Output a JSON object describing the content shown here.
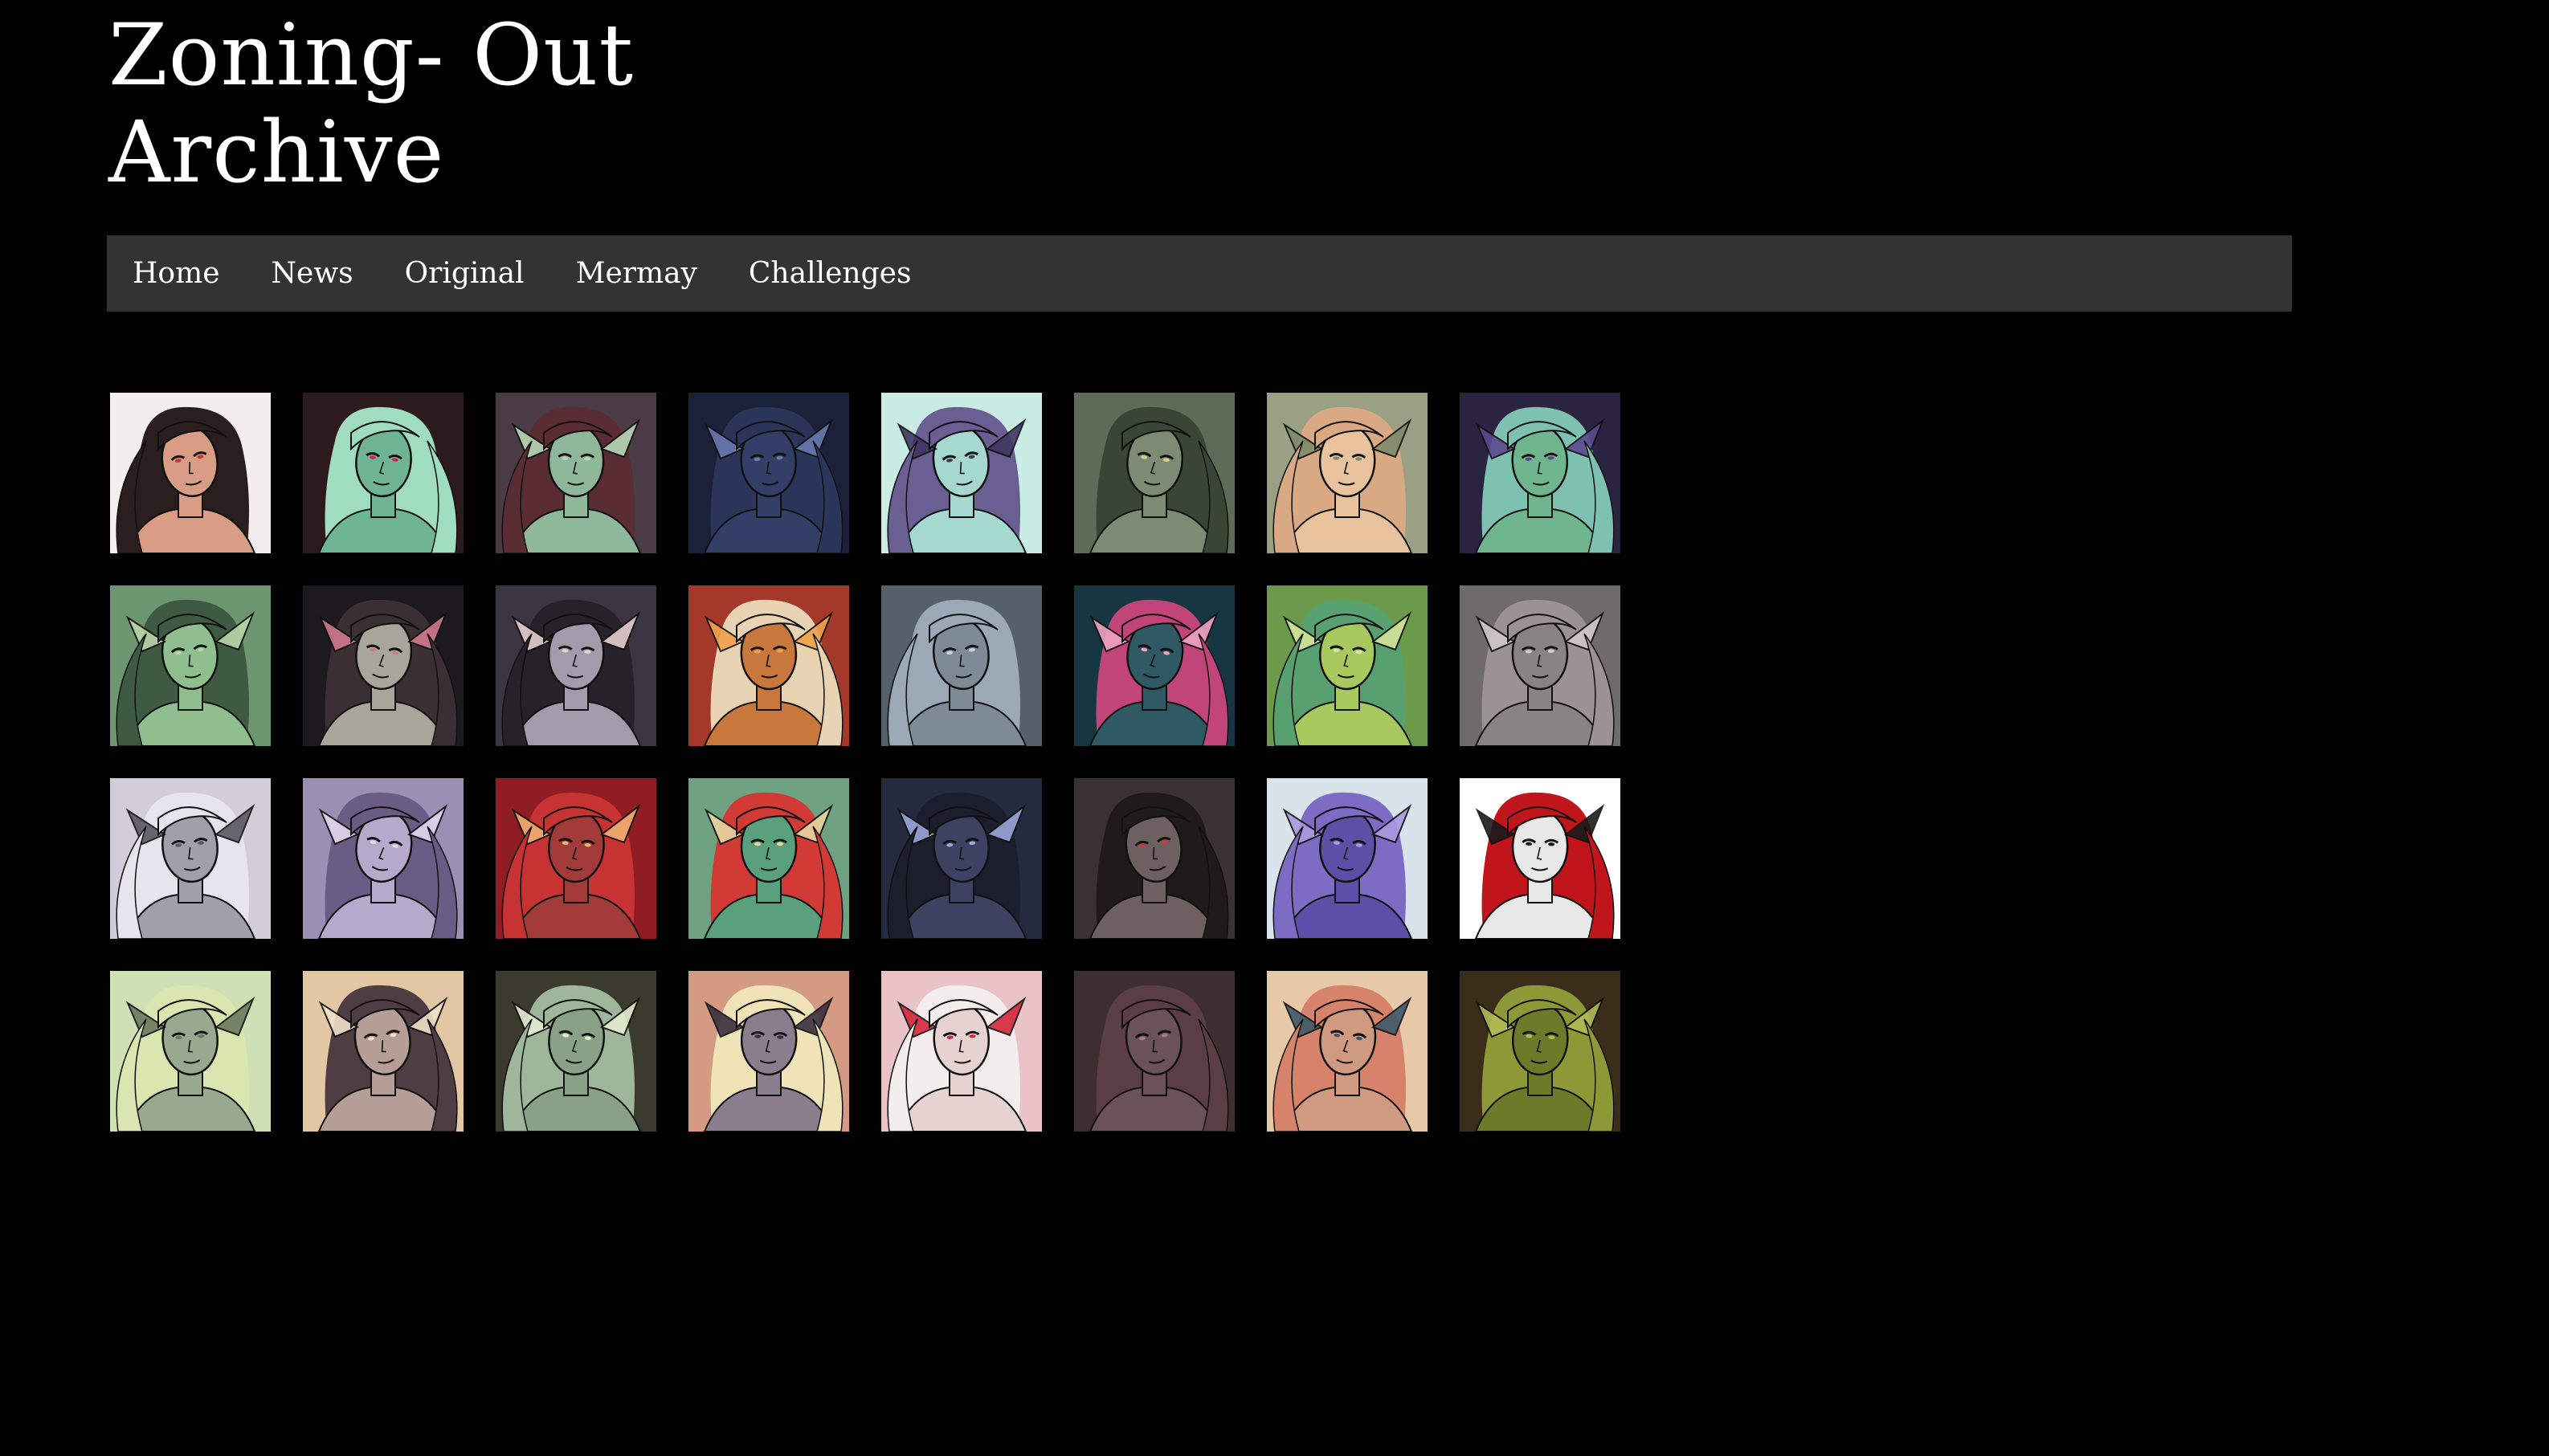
{
  "site": {
    "title_line1": "Zoning- Out",
    "title_line2": "Archive"
  },
  "nav": {
    "items": [
      {
        "label": "Home"
      },
      {
        "label": "News"
      },
      {
        "label": "Original"
      },
      {
        "label": "Mermay"
      },
      {
        "label": "Challenges"
      }
    ]
  },
  "colors": {
    "page_bg": "#000000",
    "nav_bg": "#333333",
    "text": "#ffffff"
  },
  "gallery": {
    "thumbnails": [
      {
        "bg": "#f4efee",
        "hair": "#2a1f1e",
        "skin": "#d99c84",
        "accent": "#c0392b",
        "fin": false
      },
      {
        "bg": "#2c1a1f",
        "hair": "#9fdcc0",
        "skin": "#6fb493",
        "accent": "#d6215e",
        "fin": false
      },
      {
        "bg": "#4a3b44",
        "hair": "#5a2c33",
        "skin": "#8fb79a",
        "accent": "#b8d8b6",
        "fin": true
      },
      {
        "bg": "#1b2138",
        "hair": "#2b3559",
        "skin": "#333f66",
        "accent": "#6a7ab0",
        "fin": true
      },
      {
        "bg": "#c9ece4",
        "hair": "#6a5f92",
        "skin": "#a5d9cf",
        "accent": "#3f3862",
        "fin": true
      },
      {
        "bg": "#5f6b57",
        "hair": "#3b4536",
        "skin": "#7e8b74",
        "accent": "#cfcf8a",
        "fin": false
      },
      {
        "bg": "#9aa083",
        "hair": "#d9a983",
        "skin": "#e8c39e",
        "accent": "#7e8a6a",
        "fin": true
      },
      {
        "bg": "#2b2440",
        "hair": "#7fc1b1",
        "skin": "#6fb58e",
        "accent": "#5b4a8f",
        "fin": true
      },
      {
        "bg": "#6c9670",
        "hair": "#3e5a42",
        "skin": "#8fbf8e",
        "accent": "#b9d7a8",
        "fin": true
      },
      {
        "bg": "#1d1a1e",
        "hair": "#3a3034",
        "skin": "#a8a69a",
        "accent": "#d27a8c",
        "fin": true
      },
      {
        "bg": "#3a3540",
        "hair": "#262229",
        "skin": "#a19bab",
        "accent": "#e6cfcf",
        "fin": true
      },
      {
        "bg": "#a4382b",
        "hair": "#e8d3b2",
        "skin": "#c9783c",
        "accent": "#f2a24a",
        "fin": true
      },
      {
        "bg": "#56606b",
        "hair": "#9aa9b5",
        "skin": "#7e8a96",
        "accent": "#c8d1d8",
        "fin": false
      },
      {
        "bg": "#183642",
        "hair": "#c2457a",
        "skin": "#2f5a64",
        "accent": "#f0a3c0",
        "fin": true
      },
      {
        "bg": "#6a9a4a",
        "hair": "#58a070",
        "skin": "#a8c95e",
        "accent": "#d6e59a",
        "fin": true
      },
      {
        "bg": "#6f6a6c",
        "hair": "#9c9296",
        "skin": "#8a8386",
        "accent": "#d1c8cb",
        "fin": true
      },
      {
        "bg": "#d1ced9",
        "hair": "#e6e4ec",
        "skin": "#a19fab",
        "accent": "#5a5863",
        "fin": true
      },
      {
        "bg": "#9b8fb4",
        "hair": "#6a5d85",
        "skin": "#b5a9cc",
        "accent": "#e3d8f0",
        "fin": true
      },
      {
        "bg": "#8f1d23",
        "hair": "#c73232",
        "skin": "#a23a3a",
        "accent": "#f2b06f",
        "fin": true
      },
      {
        "bg": "#6ea280",
        "hair": "#d23a35",
        "skin": "#5aa07c",
        "accent": "#e9d6a0",
        "fin": true
      },
      {
        "bg": "#262a3f",
        "hair": "#1b1e2d",
        "skin": "#3d4263",
        "accent": "#9aa7d8",
        "fin": true
      },
      {
        "bg": "#3a3133",
        "hair": "#1f1a1b",
        "skin": "#6e5f60",
        "accent": "#c93c3c",
        "fin": false
      },
      {
        "bg": "#d9e3ec",
        "hair": "#7c6cc4",
        "skin": "#5b4fa8",
        "accent": "#a89be0",
        "fin": true
      },
      {
        "bg": "#ffffff",
        "hair": "#c0161b",
        "skin": "#e8e8e8",
        "accent": "#1a1a1a",
        "fin": true
      },
      {
        "bg": "#cfe0b5",
        "hair": "#d9e6b0",
        "skin": "#98a98f",
        "accent": "#6b7a5f",
        "fin": true
      },
      {
        "bg": "#e3c7a4",
        "hair": "#4f3d44",
        "skin": "#b59e95",
        "accent": "#f1e1c9",
        "fin": true
      },
      {
        "bg": "#3b3a2e",
        "hair": "#9eb69a",
        "skin": "#89a287",
        "accent": "#e6ecd0",
        "fin": true
      },
      {
        "bg": "#d49a84",
        "hair": "#efe3b7",
        "skin": "#8a7e8e",
        "accent": "#3b2f3f",
        "fin": true
      },
      {
        "bg": "#eac3c8",
        "hair": "#f3eded",
        "skin": "#e7d2d2",
        "accent": "#d6263a",
        "fin": true
      },
      {
        "bg": "#3e2d31",
        "hair": "#5a3e44",
        "skin": "#6a5256",
        "accent": "#a77e85",
        "fin": false
      },
      {
        "bg": "#e7c9a9",
        "hair": "#d7836b",
        "skin": "#cf9a7f",
        "accent": "#3d5a6a",
        "fin": true
      },
      {
        "bg": "#3a2e1a",
        "hair": "#8d9836",
        "skin": "#6c7a2a",
        "accent": "#b3bb55",
        "fin": true
      }
    ]
  }
}
